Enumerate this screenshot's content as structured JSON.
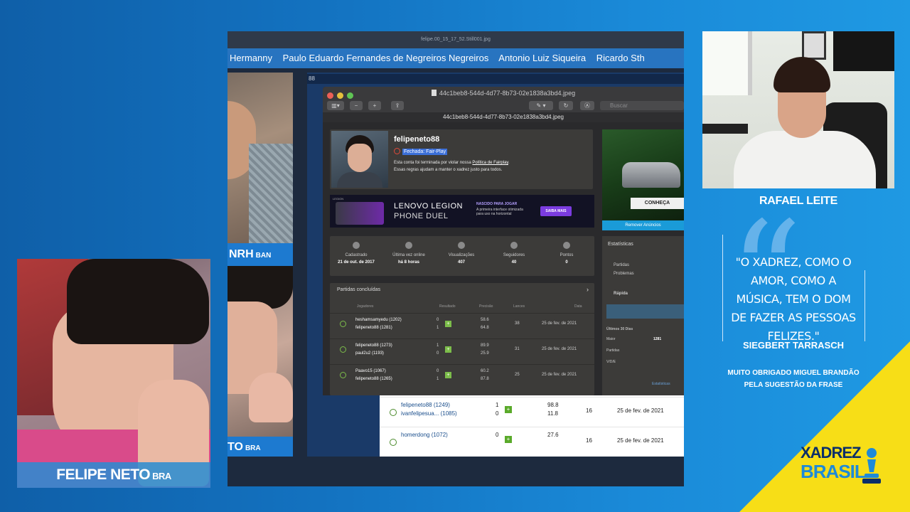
{
  "screen": {
    "window_title": "felipe.00_15_17_52.Still001.jpg",
    "names": [
      "Hermanny",
      "Paulo Eduardo Fernandes de Negreiros Negreiros",
      "Antonio Luiz Siqueira",
      "Ricardo Sth"
    ],
    "pip_top_label": "NRH",
    "pip_top_badge": "BAN",
    "pip_bottom_label": "TO",
    "pip_bottom_badge": "BRA",
    "filename_strip": "88"
  },
  "preview": {
    "title": "44c1beb8-544d-4d77-8b73-02e1838a3bd4.jpeg",
    "subtitle": "44c1beb8-544d-4d77-8b73-02e1838a3bd4.jpeg",
    "search_placeholder": "Buscar"
  },
  "profile": {
    "username": "felipeneto88",
    "status": "Fechada: Fair-Play",
    "message_line1_pre": "Esta conta foi terminada por violar nossa ",
    "message_link": "Política de Fairplay",
    "message_line1_post": ".",
    "message_line2": "Essas regras ajudam a manter o xadrez justo para todos."
  },
  "ad_banner": {
    "tag": "LEGION",
    "line1": "LENOVO LEGION",
    "line2": "PHONE DUEL",
    "kicker": "NASCIDO PARA JOGAR",
    "body": "A primeira interface otimizada para uso na horizontal",
    "cta": "SAIBA MAIS"
  },
  "side_ad": {
    "cta": "CONHEÇA",
    "remove": "Remover Anúncios"
  },
  "stats": [
    {
      "label": "Cadastrado",
      "value": "21 de out. de 2017"
    },
    {
      "label": "Última vez online",
      "value": "há 8 horas"
    },
    {
      "label": "Visualizações",
      "value": "407"
    },
    {
      "label": "Seguidores",
      "value": "40"
    },
    {
      "label": "Pontos",
      "value": "0"
    }
  ],
  "games": {
    "header": "Partidas concluídas",
    "columns": [
      "Jogadores",
      "Resultado",
      "Precisão",
      "Lances",
      "Data"
    ],
    "rows": [
      {
        "p1": "heshamsamyedu (1202)",
        "p2": "felipeneto88 (1281)",
        "r1": "0",
        "r2": "1",
        "a1": "58.6",
        "a2": "64.8",
        "moves": "38",
        "date": "25 de fev. de 2021"
      },
      {
        "p1": "felipeneto88 (1273)",
        "p2": "paul2u2 (1193)",
        "r1": "1",
        "r2": "0",
        "a1": "89.9",
        "a2": "25.9",
        "moves": "31",
        "date": "25 de fev. de 2021"
      },
      {
        "p1": "Paavo15 (1067)",
        "p2": "felipeneto88 (1265)",
        "r1": "0",
        "r2": "1",
        "a1": "60.2",
        "a2": "87.8",
        "moves": "25",
        "date": "25 de fev. de 2021"
      }
    ]
  },
  "side_stats": {
    "title": "Estatísticas",
    "item1": "Partidas",
    "item2": "Problemas",
    "rapid": "Rápida",
    "last30": "Últimos 30 Dias",
    "rows": [
      {
        "k": "Maior",
        "v": "1281"
      },
      {
        "k": "Partidas",
        "v": ""
      },
      {
        "k": "V/D/E",
        "v": ""
      }
    ],
    "more": "Estatísticas"
  },
  "white_table": {
    "rows": [
      {
        "p1": "felipeneto88 (1249)",
        "p2": "ivanfelipesua... (1085)",
        "r1": "1",
        "r2": "0",
        "a1": "98.8",
        "a2": "11.8",
        "moves": "16",
        "date": "25 de fev. de 2021"
      },
      {
        "p1": "homerdong (1072)",
        "p2": "",
        "r1": "0",
        "r2": "",
        "a1": "27.6",
        "a2": "",
        "moves": "16",
        "date": "25 de fev. de 2021"
      }
    ]
  },
  "cam_left": {
    "name": "FELIPE NETO",
    "country": "BRA"
  },
  "cam_right": {
    "name": "RAFAEL LEITE"
  },
  "quote": {
    "text": "\"O XADREZ, COMO O AMOR, COMO A MÚSICA, TEM O DOM DE FAZER AS PESSOAS FELIZES.\"",
    "author": "SIEGBERT TARRASCH",
    "thanks_line1": "MUITO OBRIGADO MIGUEL BRANDÃO",
    "thanks_line2": "PELA SUGESTÃO DA FRASE"
  },
  "logo": {
    "line1": "XADREZ",
    "line2": "BRASIL"
  },
  "colors": {
    "accent_blue": "#1a8ad8",
    "corner_yellow": "#f7de17",
    "win_green": "#7cbd4a"
  }
}
